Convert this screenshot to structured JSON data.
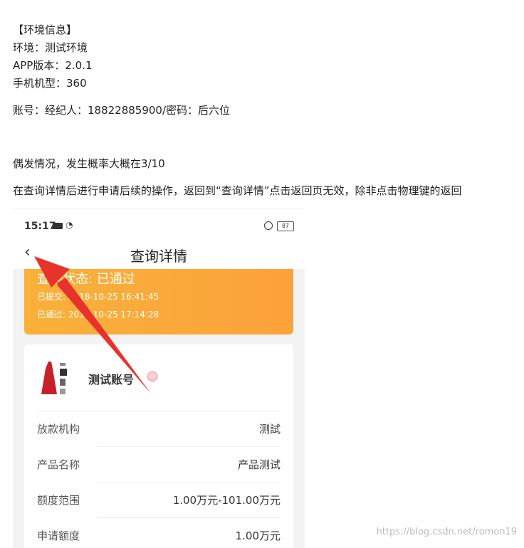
{
  "doc": {
    "env_title": "【环境信息】",
    "env_line": "环境：测试环境",
    "app_version": "APP版本：2.0.1",
    "phone_model": "手机机型：360",
    "account": "账号：经纪人：18822885900/密码：后六位",
    "frequency": "偶发情况，发生概率大概在3/10",
    "description": "在查询详情后进行申请后续的操作，返回到“查询详情”点击返回页无效，除非点击物理键的返回"
  },
  "phone": {
    "status_time": "15:17",
    "battery": "87",
    "nav_title": "查询详情",
    "back_glyph": "‹",
    "banner": {
      "status_title": "查询状态: 已通过",
      "submitted": "已提交: 2018-10-25 16:41:45",
      "passed": "已通过: 2018-10-25 17:14:28"
    },
    "product_name": "测试账号",
    "rows": [
      {
        "label": "放款机构",
        "value": "测試"
      },
      {
        "label": "产品名称",
        "value": "产品测试"
      },
      {
        "label": "额度范围",
        "value": "1.00万元-101.00万元"
      },
      {
        "label": "申请额度",
        "value": "1.00万元"
      }
    ]
  },
  "colors": {
    "banner": "#f9b13a",
    "arrow": "#e8322c"
  },
  "watermark": "https://blog.csdn.net/romon19"
}
